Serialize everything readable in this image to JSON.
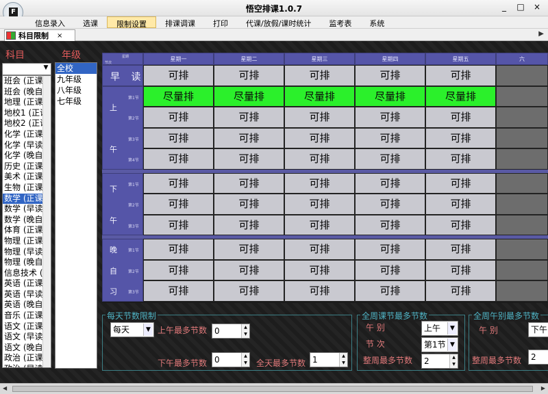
{
  "window": {
    "title": "悟空排课1.0.7",
    "icon_letter": "F",
    "buttons": [
      "_",
      "□",
      "×"
    ]
  },
  "menu": [
    "信息录入",
    "选课",
    "限制设置",
    "排课调课",
    "打印",
    "代课/放假/课时统计",
    "监考表",
    "系统"
  ],
  "menu_active_index": 2,
  "doc_tab": {
    "label": "科目限制",
    "close": "×"
  },
  "subjects_header": "科目",
  "grades_header": "年级",
  "subjects": [
    "班会 (正课",
    "班会 (晚自",
    "地理 (正课",
    "地校1 (正课",
    "地校2 (正课",
    "化学 (正课",
    "化学 (早读",
    "化学 (晚自",
    "历史 (正课",
    "美术 (正课",
    "生物 (正课",
    "数学 (正课",
    "数学 (早读",
    "数学 (晚自",
    "体育 (正课",
    "物理 (正课",
    "物理 (早读",
    "物理 (晚自",
    "信息技术 (",
    "英语 (正课",
    "英语 (早读",
    "英语 (晚自",
    "音乐 (正课",
    "语文 (正课",
    "语文 (早读",
    "语文 (晚自",
    "政治 (正课",
    "政治 (早读"
  ],
  "subjects_selected_index": 11,
  "grades": [
    "全校",
    "九年级",
    "八年级",
    "七年级"
  ],
  "grades_selected_index": 0,
  "grid": {
    "corner_top": "星期",
    "corner_bottom": "节次",
    "days": [
      "星期一",
      "星期二",
      "星期三",
      "星期四",
      "星期五",
      "六"
    ],
    "early_label": "早 读",
    "blocks": [
      {
        "chars": [
          "上",
          "午"
        ],
        "periods": [
          "第1节",
          "第2节",
          "第3节",
          "第4节"
        ]
      },
      {
        "chars": [
          "下",
          "午"
        ],
        "periods": [
          "第1节",
          "第2节",
          "第3节"
        ]
      },
      {
        "chars": [
          "晚",
          "自",
          "习"
        ],
        "periods": [
          "第1节",
          "第2节",
          "第3节"
        ]
      }
    ],
    "cell_default": "可排",
    "cell_preferred": "尽量排",
    "preferred_row": 1
  },
  "daily_limit": {
    "title": "每天节数限制",
    "day_select": "每天",
    "am_max_label": "上午最多节数",
    "am_max_value": "0",
    "pm_max_label": "下午最多节数",
    "pm_max_value": "0",
    "day_max_label": "全天最多节数",
    "day_max_value": "1"
  },
  "weekly_period_limit": {
    "title": "全周课节最多节数",
    "period_part_label": "午 别",
    "period_part_value": "上午",
    "period_label": "节 次",
    "period_value": "第1节",
    "week_max_label": "整周最多节数",
    "week_max_value": "2"
  },
  "weekly_part_limit": {
    "title": "全周午别最多节数",
    "part_label": "午 别",
    "part_value": "下午",
    "week_max_label": "整周最多节数",
    "week_max_value": "2"
  }
}
